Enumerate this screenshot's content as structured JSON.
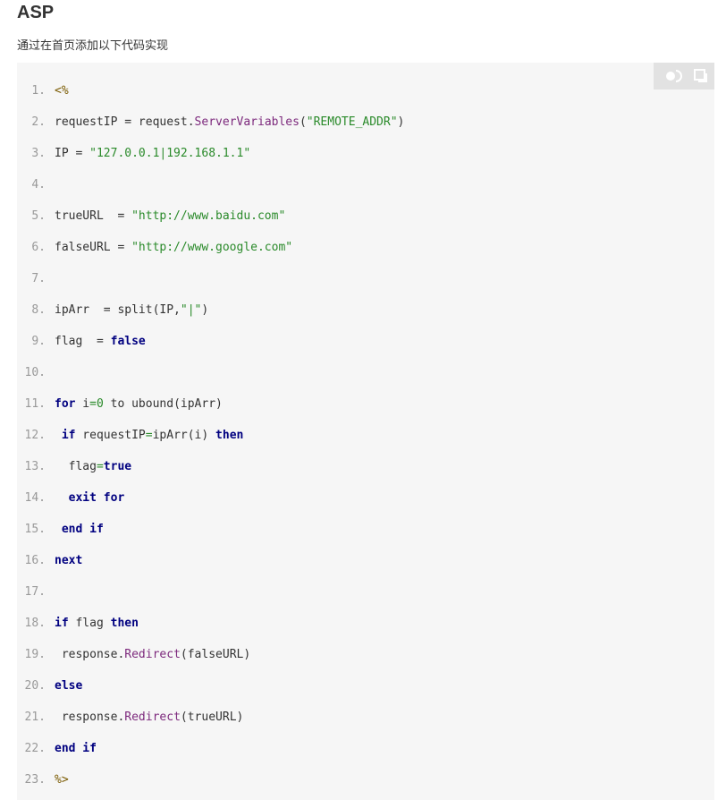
{
  "section": {
    "heading": "ASP",
    "intro": "通过在首页添加以下代码实现"
  },
  "toolbar": {
    "buttons": [
      {
        "icon": "toggle-icon"
      },
      {
        "icon": "copy-icon"
      }
    ]
  },
  "colors": {
    "code_background": "#f6f6f6",
    "keyword": "#000080",
    "string": "#2a8a2a",
    "function": "#7d2a7d",
    "line_number": "#999999"
  },
  "code": {
    "lines": [
      {
        "num": "1.",
        "tokens": [
          {
            "t": "<%",
            "c": "tag"
          }
        ]
      },
      {
        "num": "2.",
        "tokens": [
          {
            "t": "requestIP = request."
          },
          {
            "t": "ServerVariables",
            "c": "fn"
          },
          {
            "t": "("
          },
          {
            "t": "\"REMOTE_ADDR\"",
            "c": "str"
          },
          {
            "t": ")"
          }
        ]
      },
      {
        "num": "3.",
        "tokens": [
          {
            "t": "IP = "
          },
          {
            "t": "\"127.0.0.1|192.168.1.1\"",
            "c": "str"
          }
        ]
      },
      {
        "num": "4.",
        "tokens": []
      },
      {
        "num": "5.",
        "tokens": [
          {
            "t": "trueURL  = "
          },
          {
            "t": "\"http://www.baidu.com\"",
            "c": "str"
          }
        ]
      },
      {
        "num": "6.",
        "tokens": [
          {
            "t": "falseURL = "
          },
          {
            "t": "\"http://www.google.com\"",
            "c": "str"
          }
        ]
      },
      {
        "num": "7.",
        "tokens": []
      },
      {
        "num": "8.",
        "tokens": [
          {
            "t": "ipArr  = split(IP,"
          },
          {
            "t": "\"|\"",
            "c": "str"
          },
          {
            "t": ")"
          }
        ]
      },
      {
        "num": "9.",
        "tokens": [
          {
            "t": "flag  = "
          },
          {
            "t": "false",
            "c": "kw"
          }
        ]
      },
      {
        "num": "10.",
        "tokens": []
      },
      {
        "num": "11.",
        "tokens": [
          {
            "t": "for",
            "c": "kw"
          },
          {
            "t": " i"
          },
          {
            "t": "=0",
            "c": "num"
          },
          {
            "t": " to ubound(ipArr)"
          }
        ]
      },
      {
        "num": "12.",
        "tokens": [
          {
            "t": " "
          },
          {
            "t": "if",
            "c": "kw"
          },
          {
            "t": " requestIP"
          },
          {
            "t": "=",
            "c": "op"
          },
          {
            "t": "ipArr(i) "
          },
          {
            "t": "then",
            "c": "kw"
          }
        ]
      },
      {
        "num": "13.",
        "tokens": [
          {
            "t": "  flag"
          },
          {
            "t": "=",
            "c": "op"
          },
          {
            "t": "true",
            "c": "kw"
          }
        ]
      },
      {
        "num": "14.",
        "tokens": [
          {
            "t": "  "
          },
          {
            "t": "exit for",
            "c": "kw"
          }
        ]
      },
      {
        "num": "15.",
        "tokens": [
          {
            "t": " "
          },
          {
            "t": "end if",
            "c": "kw"
          }
        ]
      },
      {
        "num": "16.",
        "tokens": [
          {
            "t": "next",
            "c": "kw"
          }
        ]
      },
      {
        "num": "17.",
        "tokens": []
      },
      {
        "num": "18.",
        "tokens": [
          {
            "t": "if",
            "c": "kw"
          },
          {
            "t": " flag "
          },
          {
            "t": "then",
            "c": "kw"
          }
        ]
      },
      {
        "num": "19.",
        "tokens": [
          {
            "t": " response."
          },
          {
            "t": "Redirect",
            "c": "fn"
          },
          {
            "t": "(falseURL)"
          }
        ]
      },
      {
        "num": "20.",
        "tokens": [
          {
            "t": "else",
            "c": "kw"
          }
        ]
      },
      {
        "num": "21.",
        "tokens": [
          {
            "t": " response."
          },
          {
            "t": "Redirect",
            "c": "fn"
          },
          {
            "t": "(trueURL)"
          }
        ]
      },
      {
        "num": "22.",
        "tokens": [
          {
            "t": "end if",
            "c": "kw"
          }
        ]
      },
      {
        "num": "23.",
        "tokens": [
          {
            "t": "%>",
            "c": "tag"
          }
        ]
      }
    ]
  }
}
